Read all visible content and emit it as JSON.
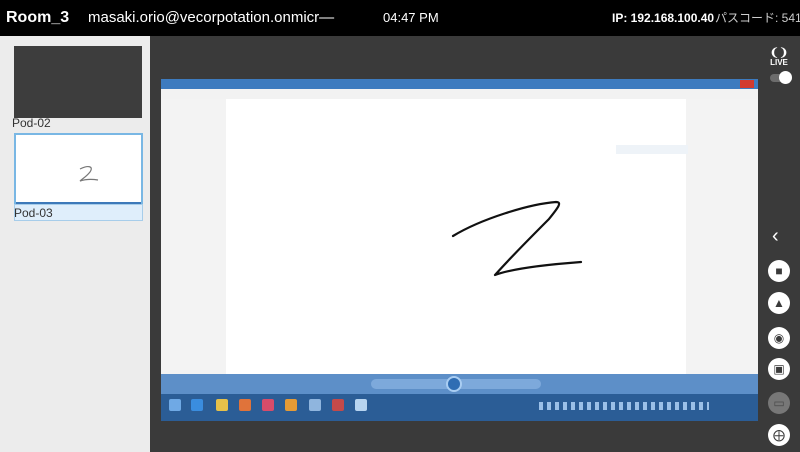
{
  "header": {
    "room": "Room_3",
    "email": "masaki.orio@vecorpotation.onmicr—",
    "time": "04:47 PM",
    "ip": "IP: 192.168.100.40",
    "passcode": "パスコード: 541"
  },
  "pods": [
    {
      "label": "Pod-02"
    },
    {
      "label": "Pod-03"
    }
  ],
  "toolbar": {
    "live_label": "LIVE",
    "icons": [
      "live-icon",
      "live-toggle",
      "chevron-left-icon",
      "comment-icon",
      "user-upload-icon",
      "camera-icon",
      "screenshot-icon",
      "trash-icon",
      "lifebuoy-icon"
    ]
  },
  "colors": {
    "selection": "#79b7e4",
    "taskbar": "#2b5d96",
    "window_title": "#3d7bbf"
  }
}
